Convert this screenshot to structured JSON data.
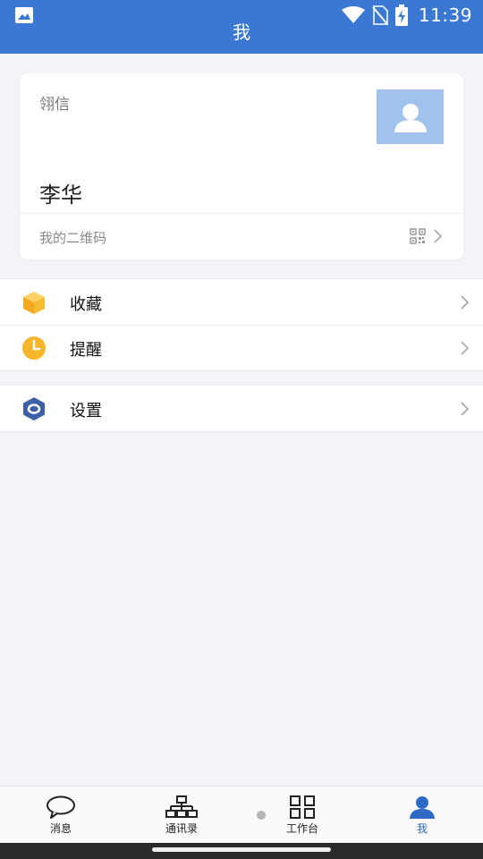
{
  "status_bar": {
    "time": "11:39",
    "icons": [
      "image-icon",
      "wifi-icon",
      "no-sim-icon",
      "battery-charging-icon"
    ]
  },
  "header": {
    "title": "我"
  },
  "profile": {
    "brand": "翎信",
    "name": "李华",
    "qr_label": "我的二维码",
    "avatar_color": "#a1c2ec"
  },
  "menu": {
    "group1": [
      {
        "label": "收藏",
        "icon": "box-icon",
        "color": "#f7b52c"
      },
      {
        "label": "提醒",
        "icon": "clock-icon",
        "color": "#f7b52c"
      }
    ],
    "group2": [
      {
        "label": "设置",
        "icon": "settings-hexagon-icon",
        "color": "#3d5fa8"
      }
    ]
  },
  "tabs": [
    {
      "label": "消息",
      "icon": "chat-bubble-icon"
    },
    {
      "label": "通讯录",
      "icon": "org-chart-icon"
    },
    {
      "label": "工作台",
      "icon": "grid-icon"
    },
    {
      "label": "我",
      "icon": "person-icon",
      "active": true
    }
  ],
  "colors": {
    "accent": "#3b78d3",
    "active_tab": "#2f69c6",
    "background": "#f3f4f8"
  }
}
